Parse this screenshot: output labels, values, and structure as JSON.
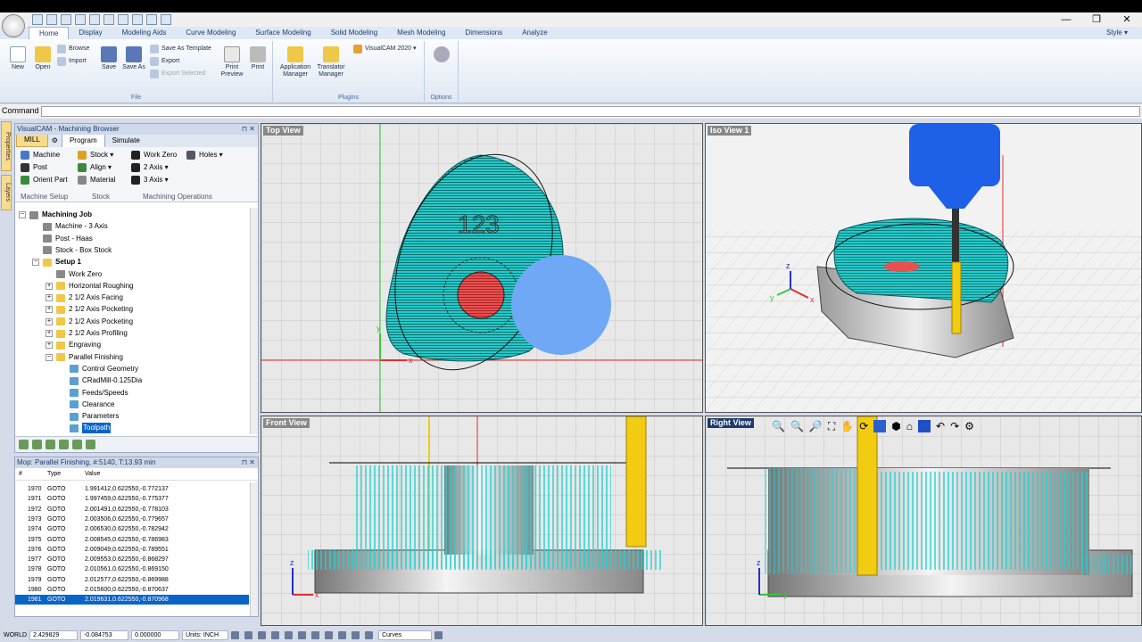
{
  "app": {
    "name": "VisualCAM"
  },
  "ribbon": {
    "tabs": [
      "Home",
      "Display",
      "Modeling Aids",
      "Curve Modeling",
      "Surface Modeling",
      "Solid Modeling",
      "Mesh Modeling",
      "Dimensions",
      "Analyze"
    ],
    "active_tab": "Home",
    "style_label": "Style",
    "file_group": {
      "label": "File",
      "new": "New",
      "open": "Open",
      "browse": "Browse",
      "import": "Import",
      "save": "Save",
      "save_as": "Save As",
      "save_as_template": "Save As Template",
      "export": "Export",
      "export_selected": "Export Selected",
      "print_preview": "Print Preview",
      "print": "Print"
    },
    "plugins_group": {
      "label": "Plugins",
      "app_manager": "Application Manager",
      "translator_manager": "Translator Manager",
      "visualcam": "VisualCAM 2020"
    },
    "options_group": {
      "label": "Options"
    }
  },
  "command": {
    "label": "Command",
    "value": ""
  },
  "side_tabs": [
    "Properties",
    "Layers"
  ],
  "browser": {
    "title": "VisualCAM - Machining Browser",
    "mode": "MILL",
    "tabs": [
      "Program",
      "Simulate"
    ],
    "active_tab": "Program",
    "machine_setup": {
      "label": "Machine Setup",
      "machine": "Machine",
      "post": "Post",
      "orient_part": "Orient Part"
    },
    "stock": {
      "label": "Stock",
      "stock": "Stock",
      "align": "Align",
      "material": "Material"
    },
    "machining_operations": {
      "label": "Machining Operations",
      "work_zero": "Work Zero",
      "axis2": "2 Axis",
      "axis3": "3 Axis",
      "holes": "Holes"
    },
    "tree": [
      {
        "label": "Machining Job",
        "level": 0,
        "bold": true,
        "exp": "⊟"
      },
      {
        "label": "Machine - 3 Axis",
        "level": 1
      },
      {
        "label": "Post - Haas",
        "level": 1
      },
      {
        "label": "Stock - Box Stock",
        "level": 1
      },
      {
        "label": "Setup 1",
        "level": 1,
        "bold": true,
        "exp": "⊟"
      },
      {
        "label": "Work Zero",
        "level": 2
      },
      {
        "label": "Horizontal Roughing",
        "level": 2,
        "exp": "⊞"
      },
      {
        "label": "2 1/2 Axis Facing",
        "level": 2,
        "exp": "⊞"
      },
      {
        "label": "2 1/2 Axis Pocketing",
        "level": 2,
        "exp": "⊞"
      },
      {
        "label": "2 1/2 Axis Pocketing",
        "level": 2,
        "exp": "⊞"
      },
      {
        "label": "2 1/2 Axis Profiling",
        "level": 2,
        "exp": "⊞"
      },
      {
        "label": "Engraving",
        "level": 2,
        "exp": "⊞"
      },
      {
        "label": "Parallel Finishing",
        "level": 2,
        "exp": "⊟"
      },
      {
        "label": "Control Geometry",
        "level": 3
      },
      {
        "label": "CRadMill-0.125Dia",
        "level": 3
      },
      {
        "label": "Feeds/Speeds",
        "level": 3
      },
      {
        "label": "Clearance",
        "level": 3
      },
      {
        "label": "Parameters",
        "level": 3
      },
      {
        "label": "Toolpath",
        "level": 3,
        "selected": true
      }
    ]
  },
  "mop": {
    "title": "Mop: Parallel Finishing, #:5140, T:13.93 min",
    "columns": [
      "#",
      "Type",
      "Value"
    ],
    "rows": [
      {
        "n": "1970",
        "type": "GOTO",
        "value": "1.991412,0.622550,-0.772137"
      },
      {
        "n": "1971",
        "type": "GOTO",
        "value": "1.997459,0.622550,-0.775377"
      },
      {
        "n": "1972",
        "type": "GOTO",
        "value": "2.001491,0.622550,-0.778103"
      },
      {
        "n": "1973",
        "type": "GOTO",
        "value": "2.003506,0.622550,-0.779657"
      },
      {
        "n": "1974",
        "type": "GOTO",
        "value": "2.006530,0.622550,-0.782942"
      },
      {
        "n": "1975",
        "type": "GOTO",
        "value": "2.008545,0.622550,-0.786983"
      },
      {
        "n": "1976",
        "type": "GOTO",
        "value": "2.009049,0.622550,-0.789551"
      },
      {
        "n": "1977",
        "type": "GOTO",
        "value": "2.009553,0.622550,-0.868297"
      },
      {
        "n": "1978",
        "type": "GOTO",
        "value": "2.010561,0.622550,-0.869150"
      },
      {
        "n": "1979",
        "type": "GOTO",
        "value": "2.012577,0.622550,-0.869988"
      },
      {
        "n": "1980",
        "type": "GOTO",
        "value": "2.015600,0.622550,-0.870637"
      },
      {
        "n": "1981",
        "type": "GOTO",
        "value": "2.019631,0.622550,-0.870968",
        "selected": true
      }
    ]
  },
  "viewports": {
    "top": {
      "label": "Top View"
    },
    "iso": {
      "label": "Iso View 1"
    },
    "front": {
      "label": "Front View"
    },
    "right": {
      "label": "Right View"
    },
    "engraving_text": "123",
    "axis_x": "x",
    "axis_y": "y",
    "axis_z": "z"
  },
  "status": {
    "coord_system": "WORLD",
    "x": "2.429829",
    "y": "-0.084753",
    "z": "0.000000",
    "units": "Units: INCH",
    "layer": "Curves"
  }
}
